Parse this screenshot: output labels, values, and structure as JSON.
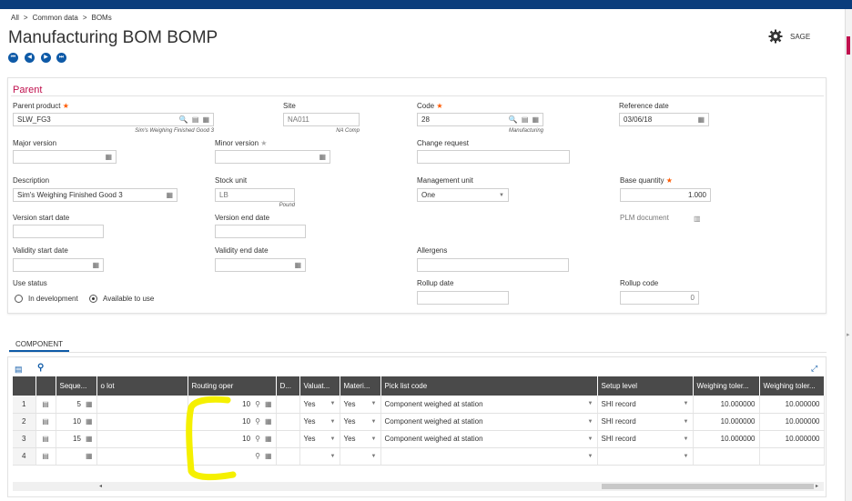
{
  "breadcrumb": {
    "all": "All",
    "sep": ">",
    "common": "Common data",
    "boms": "BOMs"
  },
  "page": {
    "title": "Manufacturing BOM BOMP"
  },
  "nav": {
    "first": "⏮",
    "prev": "◀",
    "next": "▶",
    "last": "⏭"
  },
  "header": {
    "user": "SAGE",
    "icon": "gear-icon"
  },
  "parent": {
    "title": "Parent",
    "parent_product": {
      "label": "Parent product",
      "value": "SLW_FG3",
      "caption": "Sim's Weighing Finished Good 3"
    },
    "site": {
      "label": "Site",
      "value": "NA011",
      "caption": "NA Comp"
    },
    "code": {
      "label": "Code",
      "value": "28",
      "caption": "Manufacturing"
    },
    "reference_date": {
      "label": "Reference date",
      "value": "03/06/18"
    },
    "major_version": {
      "label": "Major version",
      "value": ""
    },
    "minor_version": {
      "label": "Minor version",
      "value": ""
    },
    "change_request": {
      "label": "Change request",
      "value": ""
    },
    "description": {
      "label": "Description",
      "value": "Sim's Weighing Finished Good 3"
    },
    "stock_unit": {
      "label": "Stock unit",
      "value": "LB",
      "caption": "Pound"
    },
    "management_unit": {
      "label": "Management unit",
      "value": "One"
    },
    "base_quantity": {
      "label": "Base quantity",
      "value": "1.000"
    },
    "version_start_date": {
      "label": "Version start date",
      "value": ""
    },
    "version_end_date": {
      "label": "Version end date",
      "value": ""
    },
    "plm_document": {
      "label": "PLM document"
    },
    "validity_start_date": {
      "label": "Validity start date",
      "value": ""
    },
    "validity_end_date": {
      "label": "Validity end date",
      "value": ""
    },
    "allergens": {
      "label": "Allergens",
      "value": ""
    },
    "use_status": {
      "label": "Use status",
      "options": [
        "In development",
        "Available to use"
      ],
      "selected": "Available to use"
    },
    "rollup_date": {
      "label": "Rollup date",
      "value": ""
    },
    "rollup_code": {
      "label": "Rollup code",
      "value": "0"
    }
  },
  "component_tab": {
    "label": "COMPONENT"
  },
  "grid": {
    "headers": [
      "Seque...",
      "o lot",
      "Routing oper",
      "D...",
      "Valuat...",
      "Materi...",
      "Pick list code",
      "Setup level",
      "Weighing toler...",
      "Weighing toler..."
    ],
    "rows": [
      {
        "num": "1",
        "seq": "5",
        "routing": "10",
        "valuation": "Yes",
        "material": "Yes",
        "pick_list": "Component weighed at station",
        "setup": "SHI record",
        "tol1": "10.000000",
        "tol2": "10.000000"
      },
      {
        "num": "2",
        "seq": "10",
        "routing": "10",
        "valuation": "Yes",
        "material": "Yes",
        "pick_list": "Component weighed at station",
        "setup": "SHI record",
        "tol1": "10.000000",
        "tol2": "10.000000"
      },
      {
        "num": "3",
        "seq": "15",
        "routing": "10",
        "valuation": "Yes",
        "material": "Yes",
        "pick_list": "Component weighed at station",
        "setup": "SHI record",
        "tol1": "10.000000",
        "tol2": "10.000000"
      },
      {
        "num": "4",
        "seq": "",
        "routing": "",
        "valuation": "",
        "material": "",
        "pick_list": "",
        "setup": "",
        "tol1": "",
        "tol2": ""
      }
    ]
  },
  "colors": {
    "brand": "#0a3d7c",
    "accent": "#c0114e",
    "required": "#ff5a00",
    "highlight": "#f5f000",
    "grid_header": "#4a4a4a",
    "nav_button": "#0e5aa7"
  }
}
